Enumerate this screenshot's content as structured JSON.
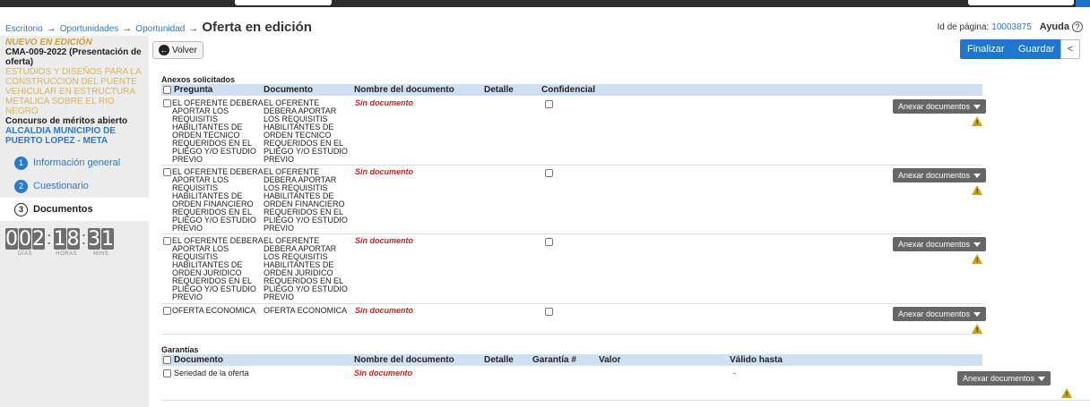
{
  "breadcrumb": {
    "items": [
      "Escritorio",
      "Oportunidades",
      "Oportunidad"
    ],
    "current": "Oferta en edición"
  },
  "page_id": {
    "label": "Id de página:",
    "value": "10003875",
    "help": "Ayuda"
  },
  "sidebar": {
    "status": "NUEVO EN EDICIÓN",
    "code": "CMA-009-2022 (Presentación de oferta)",
    "description": "ESTUDIOS Y DISEÑOS PARA LA CONSTRUCCION DEL PUENTE VEHICULAR EN ESTRUCTURA METALICA SOBRE EL RIO NEGRO",
    "type": "Concurso de méritos abierto",
    "entity": "ALCALDIA MUNICIPIO DE PUERTO LOPEZ - META",
    "steps": [
      {
        "num": "1",
        "label": "Información general"
      },
      {
        "num": "2",
        "label": "Cuestionario"
      },
      {
        "num": "3",
        "label": "Documentos"
      }
    ],
    "timer": {
      "days": "002",
      "hours": "18",
      "mins": "31",
      "days_label": "DÍAS",
      "hours_label": "HORAS",
      "mins_label": "MINS"
    }
  },
  "toolbar": {
    "volver": "Volver",
    "finalizar": "Finalizar",
    "guardar": "Guardar",
    "collapse": "<"
  },
  "anexos": {
    "title": "Anexos solicitados",
    "headers": {
      "pregunta": "Pregunta",
      "documento": "Documento",
      "nombre": "Nombre del documento",
      "detalle": "Detalle",
      "confidencial": "Confidencial"
    },
    "rows": [
      {
        "pregunta": "EL OFERENTE DEBERA APORTAR LOS REQUISITIS HABILITANTES DE ORDEN TECNICO REQUERIDOS EN EL PLIEGO Y/O ESTUDIO PREVIO",
        "documento": "EL OFERENTE DEBERA APORTAR LOS REQUISITIS HABILITANTES DE ORDEN TECNICO REQUERIDOS EN EL PLIEGO Y/O ESTUDIO PREVIO",
        "nombre": "Sin documento"
      },
      {
        "pregunta": "EL OFERENTE DEBERA APORTAR LOS REQUISITIS HABILITANTES DE ORDEN FINANCIERO REQUERIDOS EN EL PLIEGO Y/O ESTUDIO PREVIO",
        "documento": "EL OFERENTE DEBERA APORTAR LOS REQUISITIS HABILITANTES DE ORDEN FINANCIERO REQUERIDOS EN EL PLIEGO Y/O ESTUDIO PREVIO",
        "nombre": "Sin documento"
      },
      {
        "pregunta": "EL OFERENTE DEBERA APORTAR LOS REQUISITIS HABILITANTES DE ORDEN JURIDICO REQUERIDOS EN EL PLIEGO Y/O ESTUDIO PREVIO",
        "documento": "EL OFERENTE DEBERA APORTAR LOS REQUISITIS HABILITANTES DE ORDEN JURIDICO REQUERIDOS EN EL PLIEGO Y/O ESTUDIO PREVIO",
        "nombre": "Sin documento"
      },
      {
        "pregunta": "OFERTA ECONOMICA",
        "documento": "OFERTA ECONOMICA",
        "nombre": "Sin documento"
      }
    ],
    "anexar_label": "Anexar documentos"
  },
  "garantias": {
    "title": "Garantías",
    "headers": {
      "documento": "Documento",
      "nombre": "Nombre del documento",
      "detalle": "Detalle",
      "garantia": "Garantía #",
      "valor": "Valor",
      "valido": "Válido hasta"
    },
    "rows": [
      {
        "documento": "Seriedad de la oferta",
        "nombre": "Sin documento",
        "valido": "-"
      }
    ],
    "anexar_label": "Anexar documentos"
  },
  "colors": {
    "accent": "#1d77cf",
    "warning": "#c9a30e",
    "error": "#d81e1e",
    "header_bg": "#cfe0f3"
  }
}
